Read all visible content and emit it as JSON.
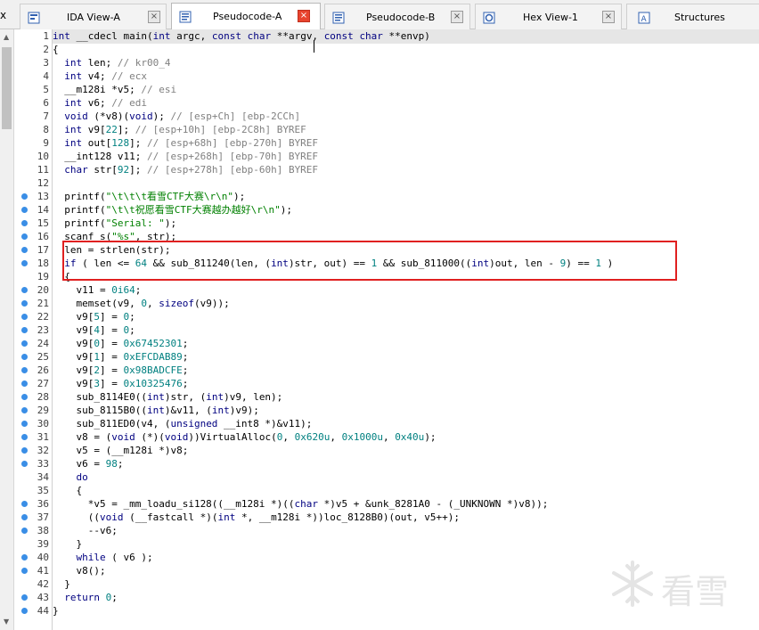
{
  "tabs": [
    {
      "label": "IDA View-A",
      "icon": "ida-view-icon",
      "active": false
    },
    {
      "label": "Pseudocode-A",
      "icon": "pseudocode-icon",
      "active": true
    },
    {
      "label": "Pseudocode-B",
      "icon": "pseudocode-icon",
      "active": false
    },
    {
      "label": "Hex View-1",
      "icon": "hex-view-icon",
      "active": false
    },
    {
      "label": "Structures",
      "icon": "structures-icon",
      "active": false
    }
  ],
  "close_glyph": "x",
  "tab_close_glyph": "×",
  "colors": {
    "keyword": "#000080",
    "number": "#008080",
    "string": "#008000",
    "comment": "#808080",
    "highlight_box": "#e02020",
    "breakpoint_dot": "#3a8ee6"
  },
  "watermark": {
    "text": "看雪",
    "icon": "snowflake-icon"
  },
  "code": [
    {
      "n": "1",
      "dot": false,
      "text": "int __cdecl main(int argc, const char **argv, const char **envp)"
    },
    {
      "n": "2",
      "dot": false,
      "text": "{"
    },
    {
      "n": "3",
      "dot": false,
      "text": "  int len; // kr00_4"
    },
    {
      "n": "4",
      "dot": false,
      "text": "  int v4; // ecx"
    },
    {
      "n": "5",
      "dot": false,
      "text": "  __m128i *v5; // esi"
    },
    {
      "n": "6",
      "dot": false,
      "text": "  int v6; // edi"
    },
    {
      "n": "7",
      "dot": false,
      "text": "  void (*v8)(void); // [esp+Ch] [ebp-2CCh]"
    },
    {
      "n": "8",
      "dot": false,
      "text": "  int v9[22]; // [esp+10h] [ebp-2C8h] BYREF"
    },
    {
      "n": "9",
      "dot": false,
      "text": "  int out[128]; // [esp+68h] [ebp-270h] BYREF"
    },
    {
      "n": "10",
      "dot": false,
      "text": "  __int128 v11; // [esp+268h] [ebp-70h] BYREF"
    },
    {
      "n": "11",
      "dot": false,
      "text": "  char str[92]; // [esp+278h] [ebp-60h] BYREF"
    },
    {
      "n": "12",
      "dot": false,
      "text": ""
    },
    {
      "n": "13",
      "dot": true,
      "text": "  printf(\"\\t\\t\\t看雪CTF大赛\\r\\n\");"
    },
    {
      "n": "14",
      "dot": true,
      "text": "  printf(\"\\t\\t祝愿看雪CTF大赛越办越好\\r\\n\");"
    },
    {
      "n": "15",
      "dot": true,
      "text": "  printf(\"Serial: \");"
    },
    {
      "n": "16",
      "dot": true,
      "text": "  scanf_s(\"%s\", str);"
    },
    {
      "n": "17",
      "dot": true,
      "text": "  len = strlen(str);"
    },
    {
      "n": "18",
      "dot": true,
      "text": "  if ( len <= 64 && sub_811240(len, (int)str, out) == 1 && sub_811000((int)out, len - 9) == 1 )"
    },
    {
      "n": "19",
      "dot": false,
      "text": "  {"
    },
    {
      "n": "20",
      "dot": true,
      "text": "    v11 = 0i64;"
    },
    {
      "n": "21",
      "dot": true,
      "text": "    memset(v9, 0, sizeof(v9));"
    },
    {
      "n": "22",
      "dot": true,
      "text": "    v9[5] = 0;"
    },
    {
      "n": "23",
      "dot": true,
      "text": "    v9[4] = 0;"
    },
    {
      "n": "24",
      "dot": true,
      "text": "    v9[0] = 0x67452301;"
    },
    {
      "n": "25",
      "dot": true,
      "text": "    v9[1] = 0xEFCDAB89;"
    },
    {
      "n": "26",
      "dot": true,
      "text": "    v9[2] = 0x98BADCFE;"
    },
    {
      "n": "27",
      "dot": true,
      "text": "    v9[3] = 0x10325476;"
    },
    {
      "n": "28",
      "dot": true,
      "text": "    sub_8114E0((int)str, (int)v9, len);"
    },
    {
      "n": "29",
      "dot": true,
      "text": "    sub_8115B0((int)&v11, (int)v9);"
    },
    {
      "n": "30",
      "dot": true,
      "text": "    sub_811ED0(v4, (unsigned __int8 *)&v11);"
    },
    {
      "n": "31",
      "dot": true,
      "text": "    v8 = (void (*)(void))VirtualAlloc(0, 0x620u, 0x1000u, 0x40u);"
    },
    {
      "n": "32",
      "dot": true,
      "text": "    v5 = (__m128i *)v8;"
    },
    {
      "n": "33",
      "dot": true,
      "text": "    v6 = 98;"
    },
    {
      "n": "34",
      "dot": false,
      "text": "    do"
    },
    {
      "n": "35",
      "dot": false,
      "text": "    {"
    },
    {
      "n": "36",
      "dot": true,
      "text": "      *v5 = _mm_loadu_si128((__m128i *)((char *)v5 + &unk_8281A0 - (_UNKNOWN *)v8));"
    },
    {
      "n": "37",
      "dot": true,
      "text": "      ((void (__fastcall *)(int *, __m128i *))loc_8128B0)(out, v5++);"
    },
    {
      "n": "38",
      "dot": true,
      "text": "      --v6;"
    },
    {
      "n": "39",
      "dot": false,
      "text": "    }"
    },
    {
      "n": "40",
      "dot": true,
      "text": "    while ( v6 );"
    },
    {
      "n": "41",
      "dot": true,
      "text": "    v8();"
    },
    {
      "n": "42",
      "dot": false,
      "text": "  }"
    },
    {
      "n": "43",
      "dot": true,
      "text": "  return 0;"
    },
    {
      "n": "44",
      "dot": true,
      "text": "}"
    }
  ]
}
